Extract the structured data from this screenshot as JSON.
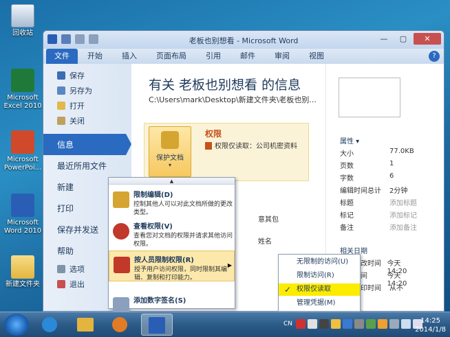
{
  "desktop": {
    "icons": [
      {
        "label": "回收站"
      },
      {
        "label": "Microsoft Excel 2010"
      },
      {
        "label": "Microsoft PowerPoi..."
      },
      {
        "label": "Microsoft Word 2010"
      },
      {
        "label": "新建文件夹"
      }
    ]
  },
  "window": {
    "title": "老板也别想看 - Microsoft Word",
    "controls": {
      "minimize": "—",
      "maximize": "▢",
      "close": "✕"
    },
    "help": "?"
  },
  "ribbon": {
    "tabs": [
      "文件",
      "开始",
      "插入",
      "页面布局",
      "引用",
      "邮件",
      "审阅",
      "视图"
    ]
  },
  "sidebar": {
    "small_items": [
      "保存",
      "另存为",
      "打开",
      "关闭"
    ],
    "big_items": [
      "信息",
      "最近所用文件",
      "新建",
      "打印",
      "保存并发送",
      "帮助"
    ],
    "bottom_items": [
      "选项",
      "退出"
    ]
  },
  "info": {
    "heading": "有关 老板也别想看 的信息",
    "path": "C:\\Users\\mark\\Desktop\\新建文件夹\\老板也别...",
    "protect_button": "保护文档",
    "protect_arrow": "▾",
    "permissions_title": "权限",
    "permissions_text": "权限仅读取：公司机密资料",
    "bg_fragments": [
      "意其包",
      "姓名"
    ]
  },
  "properties": {
    "title": "属性 ▾",
    "rows": [
      {
        "k": "大小",
        "v": "77.0KB"
      },
      {
        "k": "页数",
        "v": "1"
      },
      {
        "k": "字数",
        "v": "6"
      },
      {
        "k": "编辑时间总计",
        "v": "2分钟"
      },
      {
        "k": "标题",
        "v": "添加标题"
      },
      {
        "k": "标记",
        "v": "添加标记"
      },
      {
        "k": "备注",
        "v": "添加备注"
      }
    ],
    "related_title": "相关日期",
    "dates": [
      {
        "k": "上次修改时间",
        "v": "今天 14:20"
      },
      {
        "k": "创建时间",
        "v": "今天 14:20"
      },
      {
        "k": "上次打印时间",
        "v": "从不"
      }
    ]
  },
  "dropdown": {
    "scroll_up": "▲",
    "items": [
      {
        "title": "限制编辑(D)",
        "desc": "控制其他人可以对此文档所做的更改类型。"
      },
      {
        "title": "查看权限(V)",
        "desc": "查看您对文档的权限并请求其他访问权限。"
      },
      {
        "title": "按人员限制权限(R)",
        "desc": "授予用户访问权限，同时限制其编辑、复制和打印能力。",
        "submenu_arrow": "▶"
      },
      {
        "title": "添加数字签名(S)",
        "desc": ""
      }
    ]
  },
  "submenu": {
    "items": [
      {
        "label": "无限制的访问(U)",
        "checked": false
      },
      {
        "label": "限制访问(R)",
        "checked": false
      },
      {
        "label": "权限仅读取",
        "checked": true
      },
      {
        "label": "管理凭据(M)",
        "checked": false
      }
    ],
    "check": "✓"
  },
  "taskbar": {
    "lang": "CN",
    "time": "14:25",
    "date": "2014/1/8"
  }
}
